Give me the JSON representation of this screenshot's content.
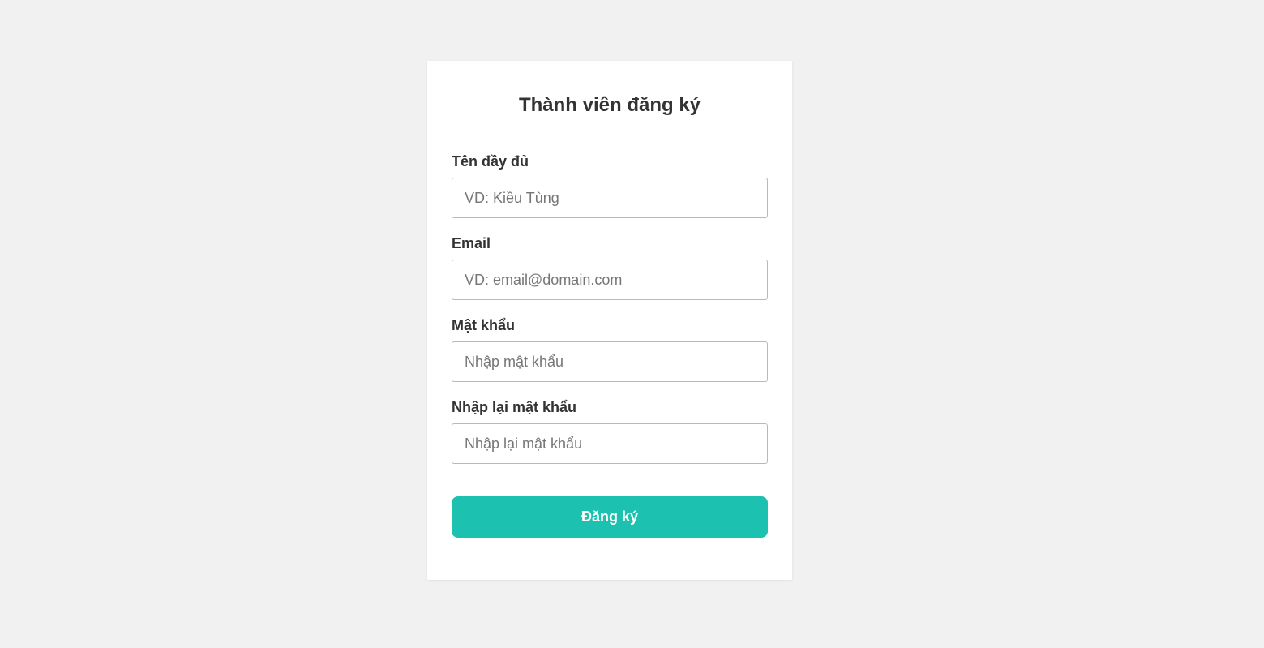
{
  "form": {
    "title": "Thành viên đăng ký",
    "fields": [
      {
        "label": "Tên đầy đủ",
        "placeholder": "VD: Kiều Tùng",
        "value": ""
      },
      {
        "label": "Email",
        "placeholder": "VD: email@domain.com",
        "value": ""
      },
      {
        "label": "Mật khẩu",
        "placeholder": "Nhập mật khẩu",
        "value": ""
      },
      {
        "label": "Nhập lại mật khẩu",
        "placeholder": "Nhập lại mật khẩu",
        "value": ""
      }
    ],
    "submit_label": "Đăng ký"
  },
  "colors": {
    "background": "#f1f1f1",
    "card": "#ffffff",
    "accent": "#1dc1b0",
    "text": "#333333"
  }
}
